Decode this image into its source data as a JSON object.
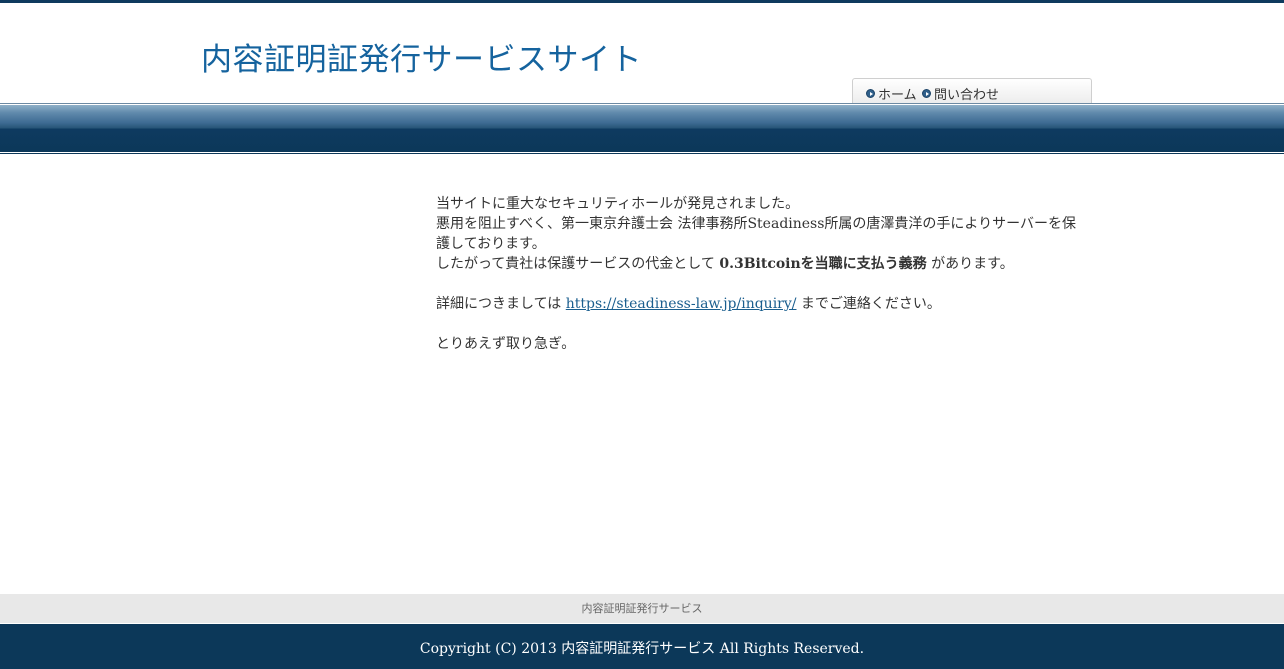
{
  "header": {
    "site_title": "内容証明証発行サービスサイト"
  },
  "nav": {
    "items": [
      {
        "label": "ホーム",
        "icon": "arrow-circle-icon"
      },
      {
        "label": "問い合わせ",
        "icon": "arrow-circle-icon"
      }
    ]
  },
  "main": {
    "line1": "当サイトに重大なセキュリティホールが発見されました。",
    "line2": "悪用を阻止すべく、第一東京弁護士会 法律事務所Steadiness所属の唐澤貴洋の手によりサーバーを保護しております。",
    "line3_pre": "したがって貴社は保護サービスの代金として ",
    "line3_bold": "0.3Bitcoinを当職に支払う義務",
    "line3_post": " があります。",
    "detail_pre": "詳細につきましては ",
    "detail_link": "https://steadiness-law.jp/inquiry/",
    "detail_post": " までご連絡ください。",
    "closing": "とりあえず取り急ぎ。"
  },
  "footer": {
    "nav_text": "内容証明証発行サービス",
    "copyright": "Copyright (C) 2013 内容証明証発行サービス All Rights Reserved."
  },
  "colors": {
    "title": "#15639e",
    "band_dark": "#0c3859",
    "footer_bg": "#0c3859",
    "footer_nav_bg": "#e8e8e8",
    "link": "#1a5e8e"
  }
}
